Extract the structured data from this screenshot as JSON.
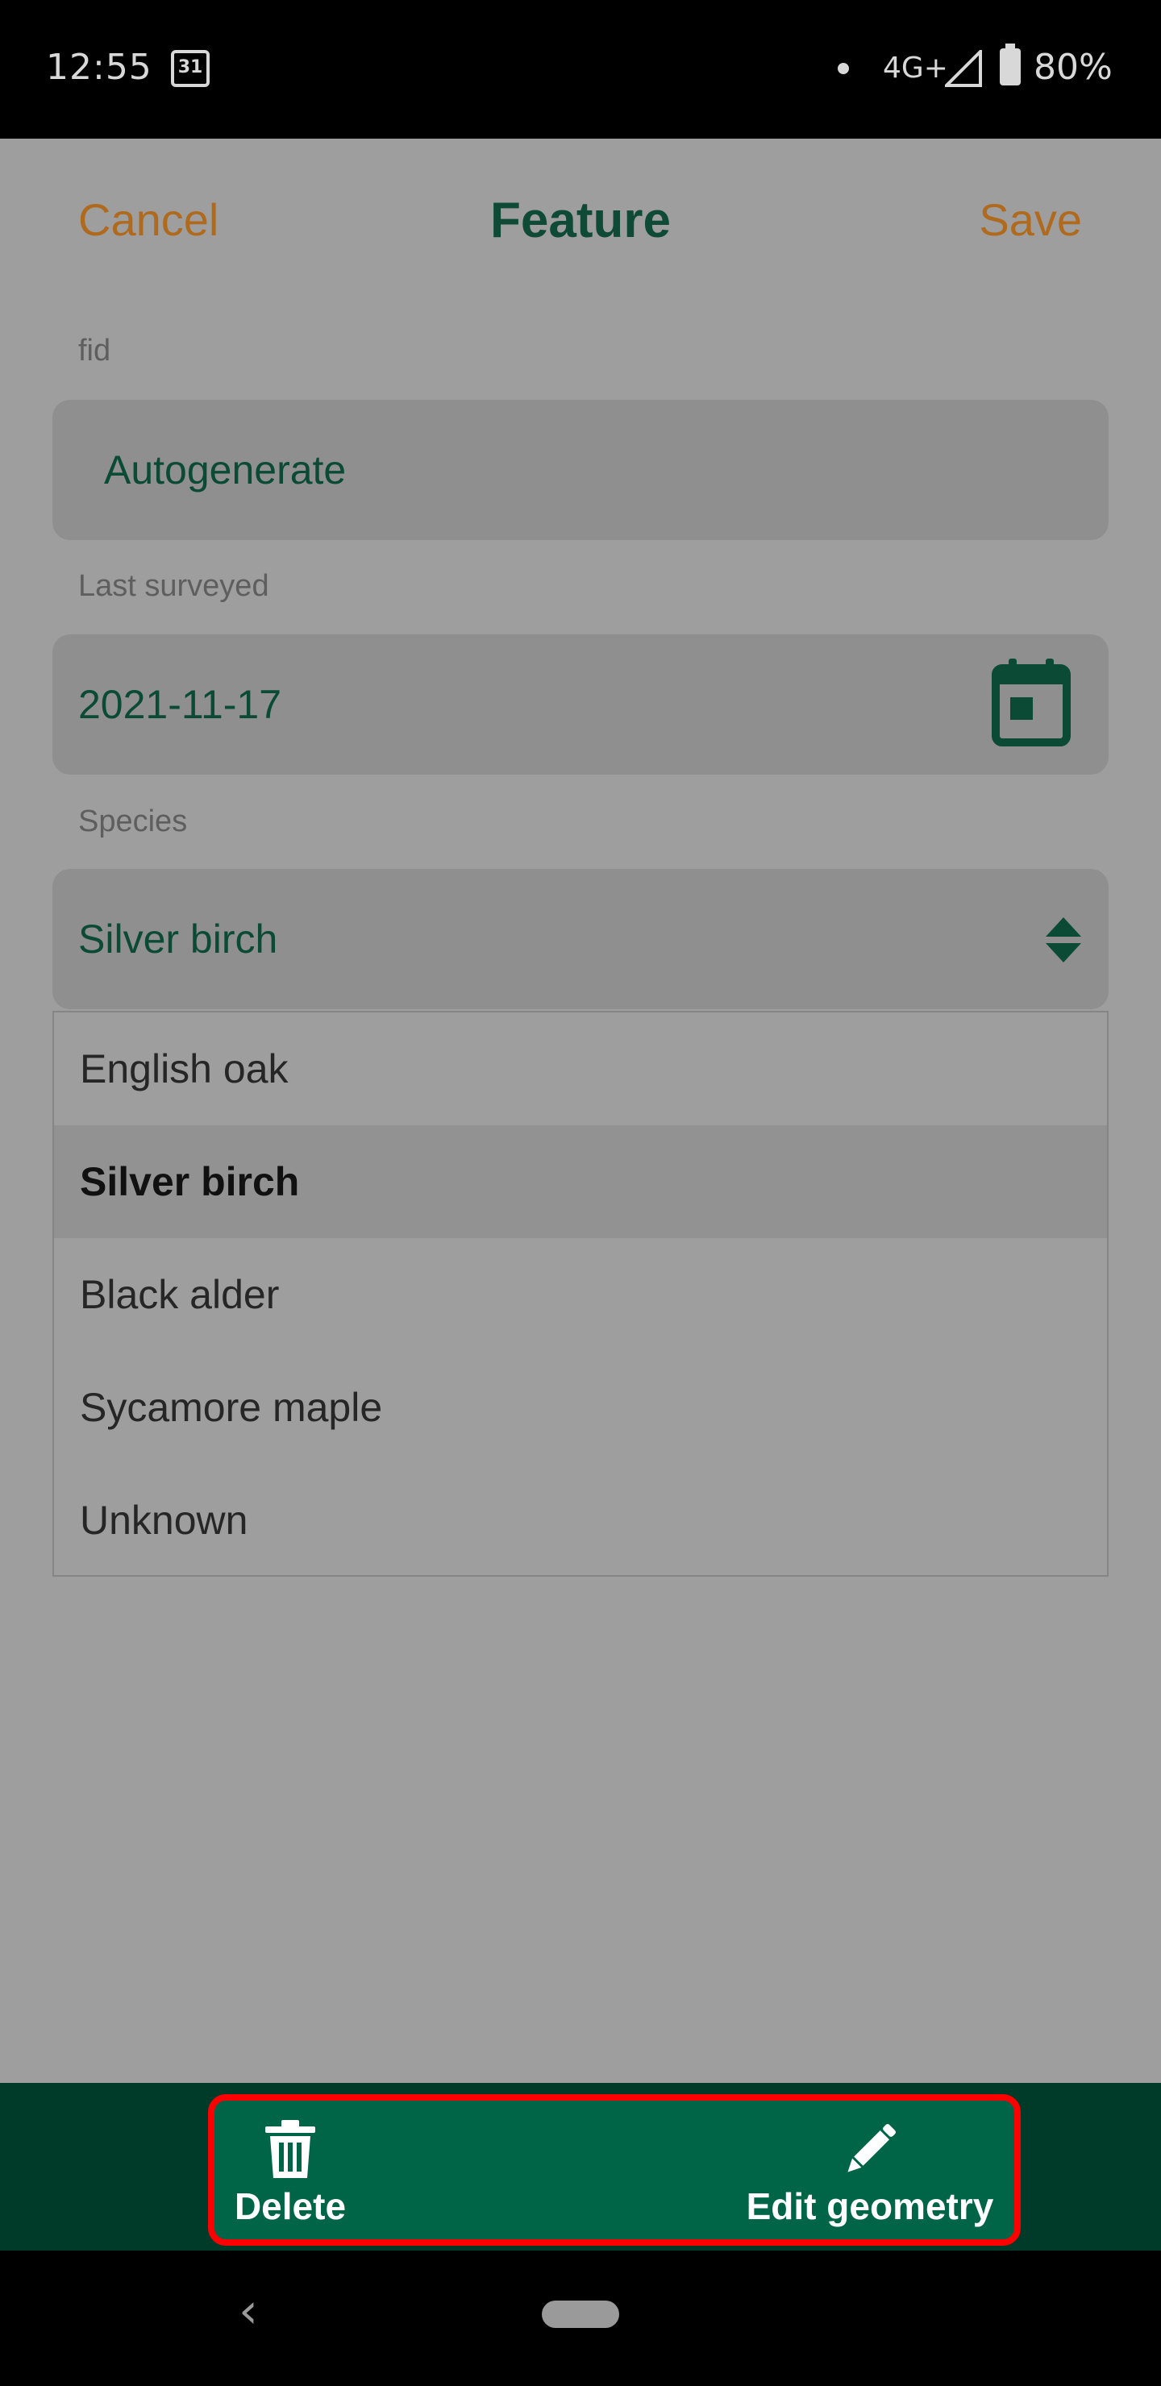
{
  "status_bar": {
    "time": "12:55",
    "calendar_day": "31",
    "network": "4G+",
    "battery_percent": "80%"
  },
  "header": {
    "cancel_label": "Cancel",
    "title": "Feature",
    "save_label": "Save"
  },
  "form": {
    "fid": {
      "label": "fid",
      "value": "Autogenerate"
    },
    "last_surveyed": {
      "label": "Last surveyed",
      "value": "2021-11-17"
    },
    "species": {
      "label": "Species",
      "value": "Silver birch"
    }
  },
  "species_options": [
    {
      "label": "English oak",
      "selected": false
    },
    {
      "label": "Silver birch",
      "selected": true
    },
    {
      "label": "Black alder",
      "selected": false
    },
    {
      "label": "Sycamore maple",
      "selected": false
    },
    {
      "label": "Unknown",
      "selected": false
    }
  ],
  "toolbar": {
    "delete_label": "Delete",
    "edit_geometry_label": "Edit geometry"
  },
  "colors": {
    "accent_orange": "#b06a1e",
    "brand_green": "#0e4a36",
    "toolbar_green": "#006547",
    "highlight_red": "#ff0000"
  },
  "icons": [
    "calendar-icon",
    "up-down-icon",
    "trash-icon",
    "pencil-icon",
    "back-icon",
    "home-pill-icon"
  ]
}
